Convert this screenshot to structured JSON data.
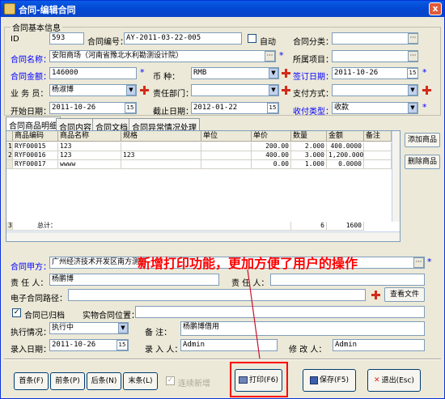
{
  "window": {
    "title": "合同-编辑合同",
    "close": "x"
  },
  "group_basic": {
    "title": "合同基本信息"
  },
  "fields": {
    "id_label": "ID",
    "id_value": "593",
    "contract_no_label": "合同编号：",
    "contract_no_value": "AY-2011-03-22-005",
    "auto_label": "自动",
    "category_label": "合同分类：",
    "category_value": "",
    "name_label": "合同名称：",
    "name_value": "安阳商场（河南省豫北水利勘测设计院）",
    "project_label": "所属项目：",
    "project_value": "",
    "amount_label": "合同金额：",
    "amount_value": "146000",
    "currency_label": "币    种：",
    "currency_value": "RMB",
    "sign_date_label": "签订日期：",
    "sign_date_value": "2011-10-26",
    "salesman_label": "业 务 员：",
    "salesman_value": "杨淑博",
    "dept_label": "责任部门：",
    "dept_value": "",
    "pay_method_label": "支付方式：",
    "pay_method_value": "",
    "start_label": "开始日期：",
    "start_value": "2011-10-26",
    "end_label": "截止日期：",
    "end_value": "2012-01-22",
    "pay_type_label": "收付类型：",
    "pay_type_value": "收款"
  },
  "tabs": [
    "合同商品明细",
    "合同内容",
    "合同文档",
    "合同异常情况处理"
  ],
  "grid": {
    "columns": [
      "商品编码",
      "商品名称",
      "规格",
      "单位",
      "单价",
      "数量",
      "金额",
      "备注"
    ],
    "rows": [
      {
        "no": "1",
        "code": "RYF00015",
        "name": "123",
        "spec": "",
        "unit": "",
        "price": "200.00",
        "qty": "2.000",
        "amount": "400.0000",
        "note": ""
      },
      {
        "no": "2",
        "code": "RYF00016",
        "name": "123",
        "spec": "123",
        "unit": "",
        "price": "400.00",
        "qty": "3.000",
        "amount": "1,200.0000",
        "note": ""
      },
      {
        "no": "",
        "code": "RYF00017",
        "name": "wwww",
        "spec": "",
        "unit": "",
        "price": "0.00",
        "qty": "1.000",
        "amount": "0.0000",
        "note": ""
      }
    ],
    "total": {
      "no": "3",
      "label": "总计：",
      "qty": "6",
      "amount": "1600"
    }
  },
  "side_buttons": {
    "add": "添加商品",
    "delete": "删除商品"
  },
  "lower": {
    "party_a_label": "合同甲方：",
    "party_a_value": "广州经济技术开发区南方测绘",
    "party_a_tail": "",
    "owner_label": "责 任 人：",
    "owner_value": "杨鹏博",
    "owner2_label": "责 任 人：",
    "owner2_value": "",
    "path_label": "电子合同路径：",
    "path_value": "",
    "view_file": "查看文件",
    "archived_label": "合同已归档",
    "archived_check": "✓",
    "location_label": "实物合同位置：",
    "location_value": "",
    "exec_label": "执行情况：",
    "exec_value": "执行中",
    "remark_label": "备    注：",
    "remark_value": "杨鹏博借用",
    "entry_date_label": "录入日期：",
    "entry_date_value": "2011-10-26",
    "entry_person_label": "录 入 人：",
    "entry_person_value": "Admin",
    "modifier_label": "修 改 人：",
    "modifier_value": "Admin"
  },
  "bottom": {
    "first": "首条(F)",
    "prev": "前条(P)",
    "next": "后条(N)",
    "last": "末条(L)",
    "continuous": "连续新增",
    "print": "打印(F6)",
    "save": "保存(F5)",
    "exit": "退出(Esc)"
  },
  "annotation": "新增打印功能，更加方便了用户的操作",
  "colors": {
    "title_bar": "#0a5ce6",
    "blue_label": "#0000ff",
    "annotation": "#ff0000"
  }
}
